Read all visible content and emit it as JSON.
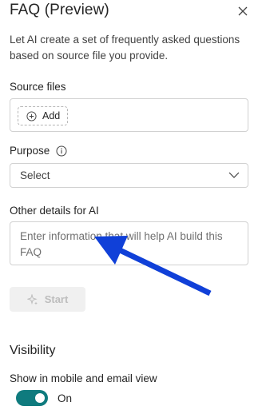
{
  "header": {
    "title": "FAQ (Preview)"
  },
  "description": "Let AI create a set of frequently asked questions based on source file you provide.",
  "source_files": {
    "label": "Source files",
    "add_label": "Add"
  },
  "purpose": {
    "label": "Purpose",
    "selected": "Select"
  },
  "other_details": {
    "label": "Other details for AI",
    "placeholder": "Enter information that will help AI build this FAQ"
  },
  "start_label": "Start",
  "visibility": {
    "heading": "Visibility",
    "toggle_label": "Show in mobile and email view",
    "toggle_state": "On",
    "toggle_on": true
  },
  "colors": {
    "toggle_accent": "#0f7b7e",
    "annotation_arrow": "#1040d8"
  },
  "icons": [
    "close-icon",
    "plus-circle-icon",
    "info-icon",
    "chevron-down-icon",
    "sparkle-icon"
  ]
}
